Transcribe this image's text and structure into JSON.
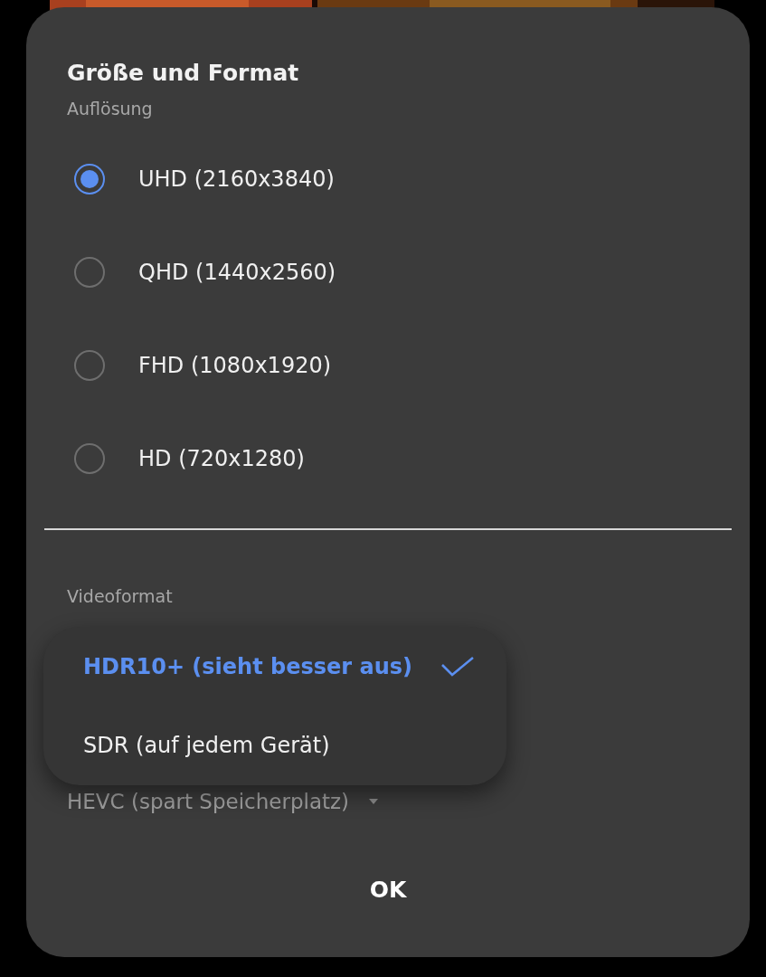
{
  "dialog": {
    "title": "Größe und Format",
    "resolution": {
      "label": "Auflösung",
      "options": [
        {
          "label": "UHD (2160x3840)",
          "selected": true
        },
        {
          "label": "QHD (1440x2560)",
          "selected": false
        },
        {
          "label": "FHD (1080x1920)",
          "selected": false
        },
        {
          "label": "HD (720x1280)",
          "selected": false
        }
      ]
    },
    "video_format": {
      "label": "Videoformat",
      "dropdown_value": "HEVC (spart Speicherplatz)",
      "menu": [
        {
          "label": "HDR10+ (sieht besser aus)",
          "selected": true
        },
        {
          "label": "SDR (auf jedem Gerät)",
          "selected": false
        }
      ]
    },
    "buttons": [
      "OK"
    ]
  }
}
